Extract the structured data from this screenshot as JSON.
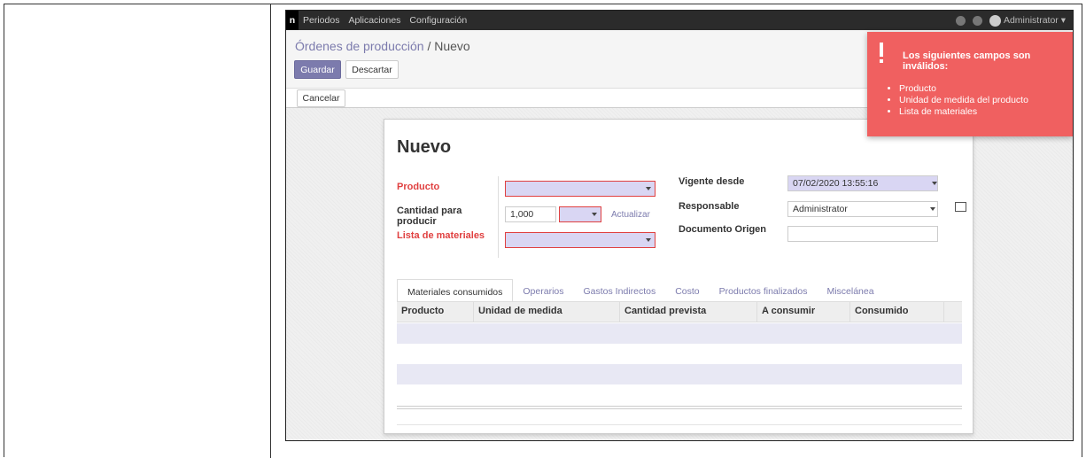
{
  "topbar": {
    "brand": "n",
    "menu": [
      "Periodos",
      "Aplicaciones",
      "Configuración"
    ],
    "user": "Administrator ▾"
  },
  "breadcrumb": {
    "parent": "Órdenes de producción",
    "separator": "/",
    "current": "Nuevo"
  },
  "buttons": {
    "save": "Guardar",
    "discard": "Descartar",
    "cancel": "Cancelar"
  },
  "form": {
    "title": "Nuevo",
    "product_label": "Producto",
    "qty_label": "Cantidad para producir",
    "qty_value": "1,000",
    "update_link": "Actualizar",
    "bom_label": "Lista de materiales",
    "valid_from_label": "Vigente desde",
    "valid_from_value": "07/02/2020 13:55:16",
    "responsible_label": "Responsable",
    "responsible_value": "Administrator",
    "origin_label": "Documento Origen"
  },
  "tabs": [
    "Materiales consumidos",
    "Operarios",
    "Gastos Indirectos",
    "Costo",
    "Productos finalizados",
    "Miscelánea"
  ],
  "table": {
    "columns": [
      "Producto",
      "Unidad de medida",
      "Cantidad prevista",
      "A consumir",
      "Consumido"
    ]
  },
  "toast": {
    "title": "Los siguientes campos son inválidos:",
    "items": [
      "Producto",
      "Unidad de medida del producto",
      "Lista de materiales"
    ]
  },
  "colors": {
    "primary": "#7c7bad",
    "error": "#f06060",
    "topbar": "#2b2b2b"
  }
}
